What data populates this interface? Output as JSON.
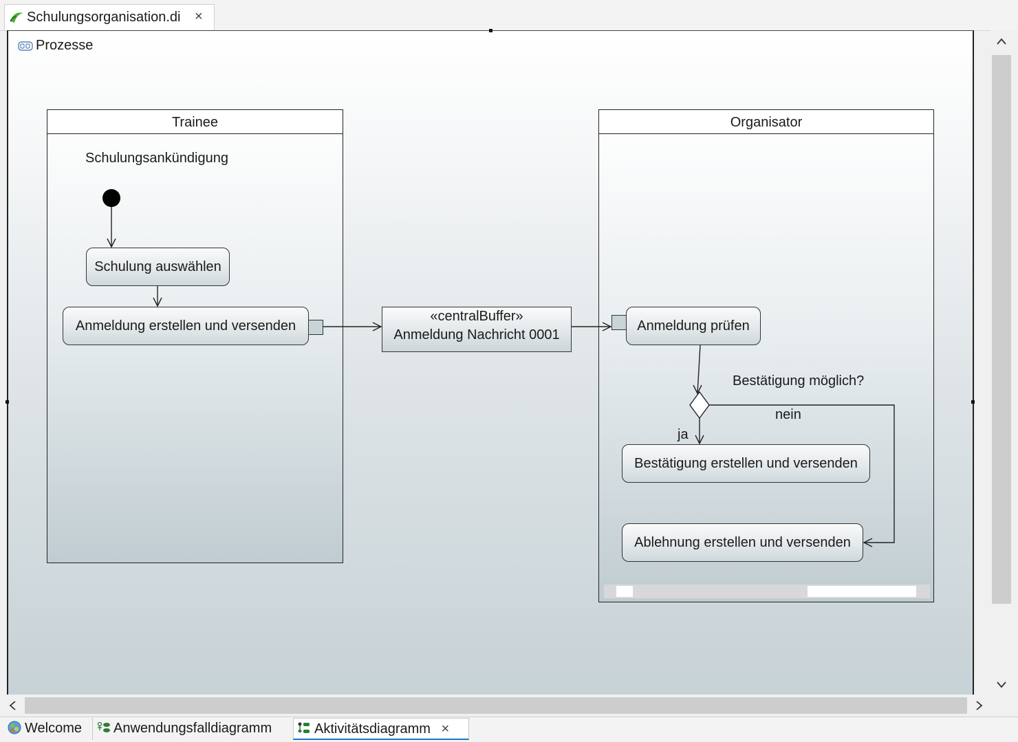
{
  "editor_tab": {
    "label": "Schulungsorganisation.di",
    "close": "×"
  },
  "activity": {
    "name": "Prozesse"
  },
  "partitions": [
    {
      "name": "Trainee"
    },
    {
      "name": "Organisator"
    }
  ],
  "trainee": {
    "signal_label": "Schulungsankündigung",
    "action_select": "Schulung auswählen",
    "action_register": "Anmeldung erstellen und versenden"
  },
  "buffer": {
    "stereotype": "«centralBuffer»",
    "name": "Anmeldung Nachricht 0001"
  },
  "organisator": {
    "action_check": "Anmeldung prüfen",
    "decision_label": "Bestätigung möglich?",
    "guard_no": "nein",
    "guard_yes": "ja",
    "action_confirm": "Bestätigung erstellen und versenden",
    "action_reject": "Ablehnung erstellen und versenden"
  },
  "scroll": {
    "up": "^",
    "down": "v",
    "left": "<",
    "right": ">"
  },
  "bottom_tabs": [
    {
      "label": "Welcome",
      "icon": "welcome-icon"
    },
    {
      "label": "Anwendungsfalldiagramm",
      "icon": "use-case-diagram-icon"
    },
    {
      "label": "Aktivitätsdiagramm",
      "icon": "activity-diagram-icon",
      "active": true,
      "close": "×"
    }
  ],
  "colors": {
    "active_tab_underline": "#1e73c8",
    "editor_icon": "#4caf2e"
  }
}
